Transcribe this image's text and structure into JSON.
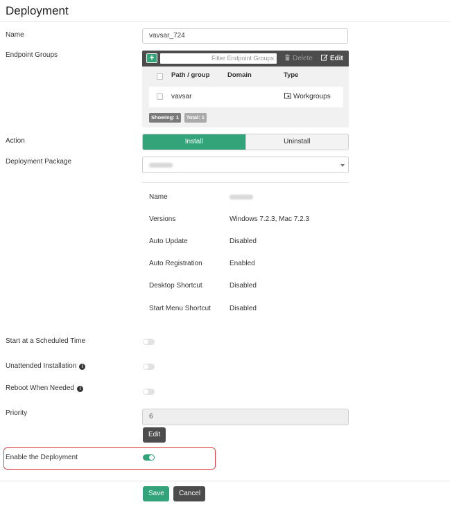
{
  "page": {
    "title": "Deployment"
  },
  "fields": {
    "name_label": "Name",
    "name_value": "vavsar_724",
    "endpoint_groups_label": "Endpoint Groups",
    "action_label": "Action",
    "deployment_package_label": "Deployment Package",
    "start_scheduled_label": "Start at a Scheduled Time",
    "unattended_label": "Unattended Installation",
    "reboot_label": "Reboot When Needed",
    "priority_label": "Priority",
    "priority_value": "6",
    "enable_label": "Enable the Deployment"
  },
  "endpoint_groups": {
    "filter_placeholder": "Filter Endpoint Groups",
    "delete_label": "Delete",
    "edit_label": "Edit",
    "columns": [
      "Path / group",
      "Domain",
      "Type"
    ],
    "rows": [
      {
        "path": "vavsar",
        "domain": "",
        "type": "Workgroups"
      }
    ],
    "showing": "Showing: 1",
    "total": "Total: 1"
  },
  "action": {
    "options": [
      "Install",
      "Uninstall"
    ],
    "selected": "Install"
  },
  "package_details": [
    {
      "key": "Name",
      "value": ""
    },
    {
      "key": "Versions",
      "value": "Windows 7.2.3, Mac 7.2.3"
    },
    {
      "key": "Auto Update",
      "value": "Disabled"
    },
    {
      "key": "Auto Registration",
      "value": "Enabled"
    },
    {
      "key": "Desktop Shortcut",
      "value": "Disabled"
    },
    {
      "key": "Start Menu Shortcut",
      "value": "Disabled"
    }
  ],
  "toggles": {
    "start_scheduled": false,
    "unattended": false,
    "reboot": false,
    "enable_deployment": true
  },
  "buttons": {
    "priority_edit": "Edit",
    "save": "Save",
    "cancel": "Cancel"
  },
  "colors": {
    "accent": "#33a37a",
    "dark": "#4c4c4c",
    "highlight": "#e0393e"
  },
  "icons": {
    "add": "plus-icon",
    "delete": "trash-icon",
    "edit": "edit-icon",
    "workgroup": "workgroup-icon",
    "info": "info-icon",
    "dropdown": "chevron-down-icon"
  }
}
